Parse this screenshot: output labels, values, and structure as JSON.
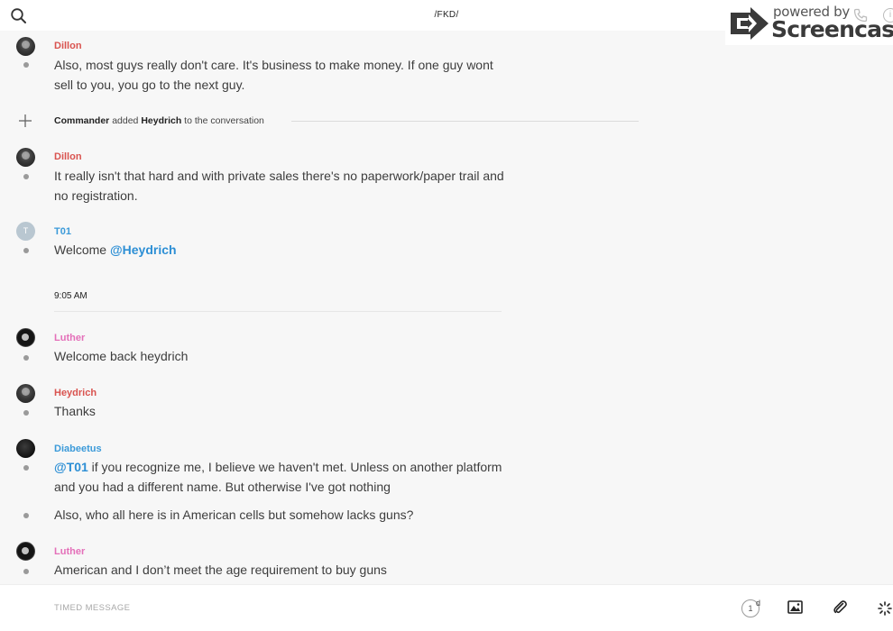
{
  "header": {
    "title": "/FKD/",
    "search_icon": "search-icon"
  },
  "watermark": {
    "powered_by": "powered by",
    "brand": "Screencastify"
  },
  "messages": [
    {
      "sender": "Dillon",
      "sender_color": "#d9534f",
      "avatar": "avatar-dark",
      "lines": [
        "Also, most guys really don't care. It's business to make money. If one guy wont sell to you, you go to the next guy."
      ]
    },
    {
      "system": {
        "actor": "Commander",
        "action": "added",
        "target": "Heydrich",
        "suffix": "to the conversation"
      }
    },
    {
      "sender": "Dillon",
      "sender_color": "#d9534f",
      "avatar": "avatar-dark",
      "lines": [
        "It really isn't that hard and with private sales there's no paperwork/paper trail and no registration."
      ]
    },
    {
      "sender": "T01",
      "sender_color": "#3b9ad9",
      "avatar_letter": "T",
      "text_prefix": "Welcome",
      "mention": "@Heydrich"
    },
    {
      "timestamp": "9:05 AM"
    },
    {
      "sender": "Luther",
      "sender_color": "#e46fb9",
      "avatar": "avatar-luther",
      "lines": [
        "Welcome back heydrich"
      ]
    },
    {
      "sender": "Heydrich",
      "sender_color": "#d9534f",
      "avatar": "avatar-dark",
      "lines": [
        "Thanks"
      ]
    },
    {
      "sender": "Diabeetus",
      "sender_color": "#3b9ad9",
      "avatar": "avatar-black",
      "mention": "@T01",
      "text": "if you recognize me, I believe we haven't met. Unless on another platform and you had a different name. But otherwise I've got nothing",
      "followup": "Also, who all here is in American cells but somehow lacks guns?"
    },
    {
      "sender": "Luther",
      "sender_color": "#e46fb9",
      "avatar": "avatar-luther",
      "lines": [
        "American and I don’t meet the age requirement to buy guns"
      ]
    }
  ],
  "composer": {
    "placeholder": "TIMED MESSAGE",
    "timer_value": "1",
    "timer_unit": "d",
    "icons": [
      "timer-icon",
      "image-icon",
      "paperclip-icon",
      "spinner-icon"
    ]
  }
}
